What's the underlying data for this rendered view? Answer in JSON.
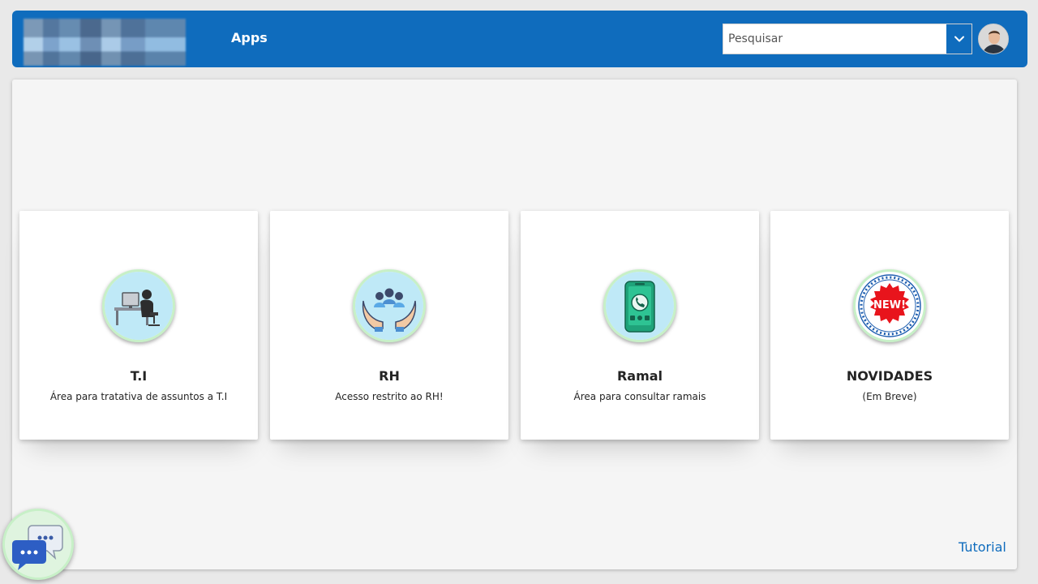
{
  "header": {
    "app_title": "Apps",
    "search": {
      "placeholder": "Pesquisar",
      "value": ""
    },
    "icons": {
      "dropdown": "chevron-down-icon",
      "avatar": "user-avatar"
    }
  },
  "cards": [
    {
      "title": "T.I",
      "description": "Área para tratativa de assuntos a T.I",
      "icon": "it-support-desk-icon"
    },
    {
      "title": "RH",
      "description": "Acesso restrito ao RH!",
      "icon": "hands-people-icon"
    },
    {
      "title": "Ramal",
      "description": "Área para consultar ramais",
      "icon": "phone-extension-icon"
    },
    {
      "title": "NOVIDADES",
      "description": "(Em Breve)",
      "icon": "new-badge-icon",
      "badge_text": "NEW!"
    }
  ],
  "footer": {
    "tutorial_label": "Tutorial",
    "chat_icon": "chat-bubbles-icon"
  },
  "colors": {
    "brand_blue": "#0f6cbd",
    "panel_bg": "#f5f5f5",
    "icon_ring": "#c7f0c7",
    "badge_red": "#e8141c"
  }
}
